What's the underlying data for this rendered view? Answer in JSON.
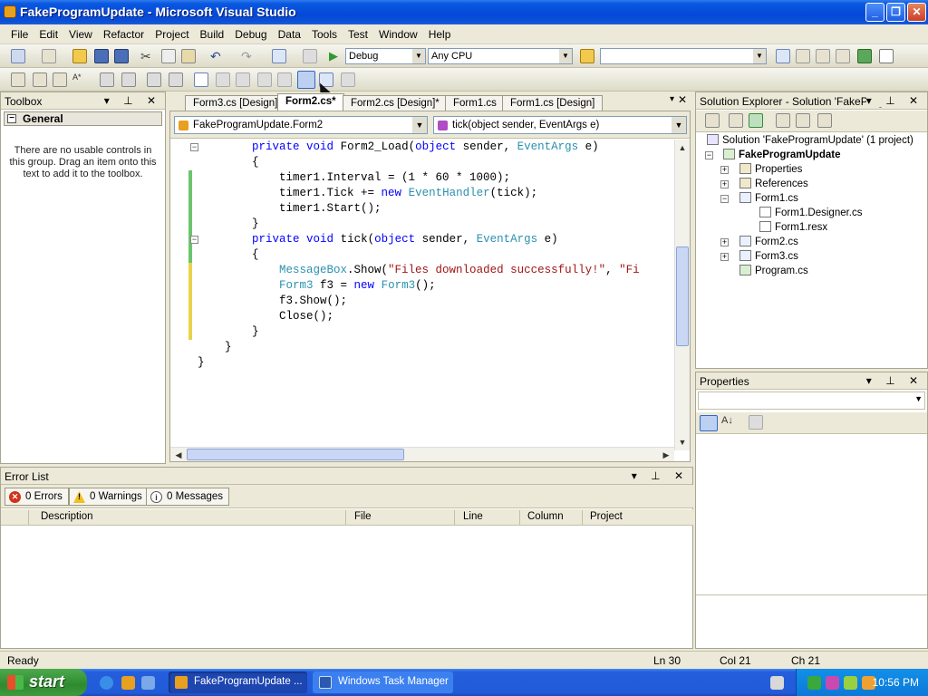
{
  "window": {
    "title": "FakeProgramUpdate - Microsoft Visual Studio"
  },
  "menu": [
    "File",
    "Edit",
    "View",
    "Refactor",
    "Project",
    "Build",
    "Debug",
    "Data",
    "Tools",
    "Test",
    "Window",
    "Help"
  ],
  "toolbar": {
    "config": "Debug",
    "platform": "Any CPU",
    "find": ""
  },
  "toolbox": {
    "title": "Toolbox",
    "group": "General",
    "message": "There are no usable controls in this group. Drag an item onto this text to add it to the toolbox."
  },
  "tabs": [
    "Form3.cs [Design]",
    "Form2.cs*",
    "Form2.cs [Design]*",
    "Form1.cs",
    "Form1.cs [Design]"
  ],
  "editor": {
    "class_combo": "FakeProgramUpdate.Form2",
    "member_combo": "tick(object sender, EventArgs e)",
    "lines": [
      "        private void Form2_Load(object sender, EventArgs e)",
      "        {",
      "            timer1.Interval = (1 * 60 * 1000);",
      "            timer1.Tick += new EventHandler(tick);",
      "            timer1.Start();",
      "        }",
      "        private void tick(object sender, EventArgs e)",
      "        {",
      "            MessageBox.Show(\"Files downloaded successfully!\", \"Fi",
      "            Form3 f3 = new Form3();",
      "            f3.Show();",
      "            Close();",
      "        }",
      "    }",
      "}"
    ]
  },
  "solution": {
    "title": "Solution Explorer - Solution 'FakeProgr...",
    "items": [
      {
        "label": "Solution 'FakeProgramUpdate' (1 project)"
      },
      {
        "label": "FakeProgramUpdate"
      },
      {
        "label": "Properties"
      },
      {
        "label": "References"
      },
      {
        "label": "Form1.cs"
      },
      {
        "label": "Form1.Designer.cs"
      },
      {
        "label": "Form1.resx"
      },
      {
        "label": "Form2.cs"
      },
      {
        "label": "Form3.cs"
      },
      {
        "label": "Program.cs"
      }
    ]
  },
  "properties": {
    "title": "Properties"
  },
  "errorlist": {
    "title": "Error List",
    "errors": "0 Errors",
    "warnings": "0 Warnings",
    "messages": "0 Messages",
    "columns": [
      "Description",
      "File",
      "Line",
      "Column",
      "Project"
    ]
  },
  "status": {
    "text": "Ready",
    "ln": "Ln 30",
    "col": "Col 21",
    "ch": "Ch 21"
  },
  "taskbar": {
    "start": "start",
    "tasks": [
      "FakeProgramUpdate ...",
      "Windows Task Manager"
    ],
    "clock": "10:56 PM"
  }
}
